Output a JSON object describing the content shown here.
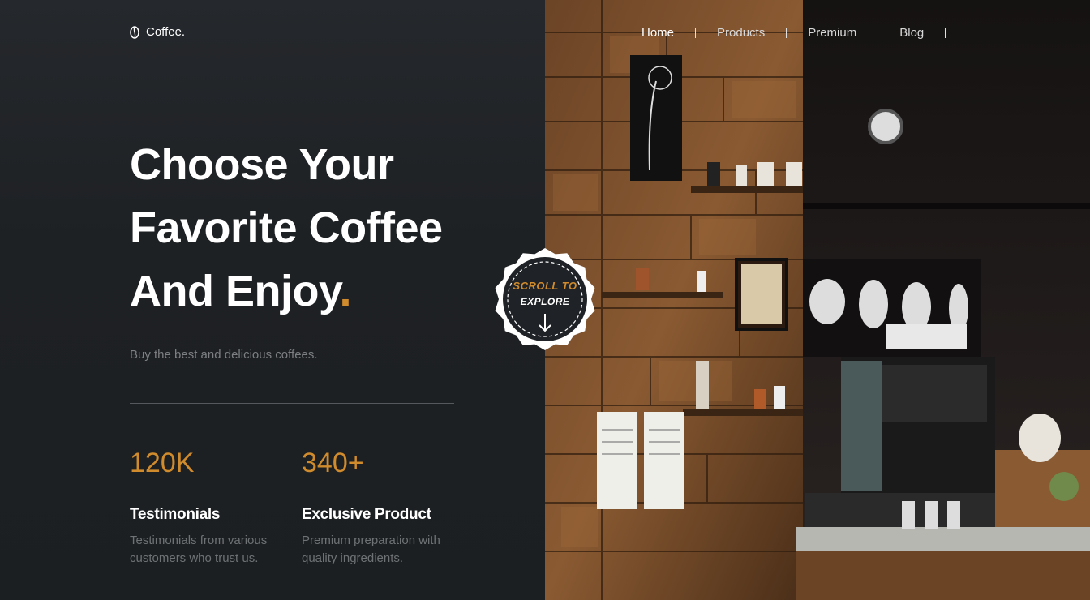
{
  "brand": {
    "name": "Coffee.",
    "icon": "coffee-bean-icon"
  },
  "nav": {
    "items": [
      {
        "label": "Home",
        "active": true
      },
      {
        "label": "Products",
        "active": false
      },
      {
        "label": "Premium",
        "active": false
      },
      {
        "label": "Blog",
        "active": false
      }
    ]
  },
  "hero": {
    "headline_line1": "Choose Your",
    "headline_line2": "Favorite Coffee",
    "headline_line3": "And Enjoy",
    "headline_dot": ".",
    "subtitle": "Buy the best and delicious coffees."
  },
  "scroll_badge": {
    "line1": "SCROLL TO",
    "line2": "EXPLORE",
    "icon": "arrow-down-icon"
  },
  "stats": [
    {
      "value": "120K",
      "label": "Testimonials",
      "desc_line1": "Testimonials from various",
      "desc_line2": "customers who trust us."
    },
    {
      "value": "340+",
      "label": "Exclusive Product",
      "desc_line1": "Premium preparation with",
      "desc_line2": "quality ingredients."
    }
  ],
  "colors": {
    "accent": "#d08b2c",
    "background": "#1e2124",
    "text": "#ffffff",
    "muted": "#7d7f82"
  }
}
